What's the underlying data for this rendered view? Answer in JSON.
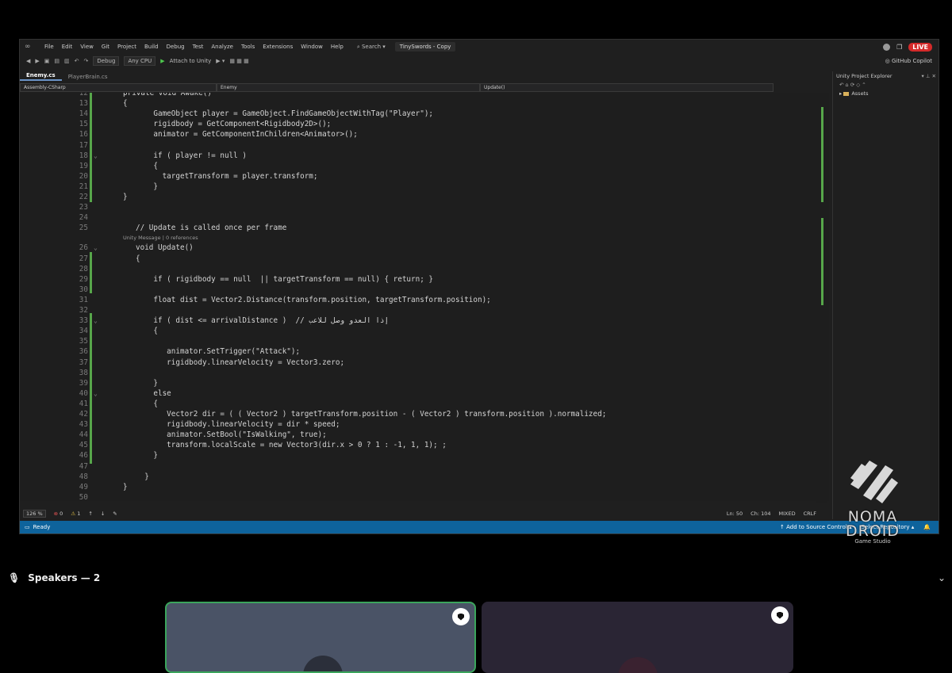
{
  "menubar": {
    "items": [
      "File",
      "Edit",
      "View",
      "Git",
      "Project",
      "Build",
      "Debug",
      "Test",
      "Analyze",
      "Tools",
      "Extensions",
      "Window",
      "Help"
    ],
    "search": "Search",
    "project": "TinySwords - Copy",
    "live": "LIVE"
  },
  "toolbar": {
    "config": "Debug",
    "platform": "Any CPU",
    "attach": "Attach to Unity",
    "copilot": "GitHub Copilot"
  },
  "tabs": [
    "Enemy.cs",
    "PlayerBrain.cs"
  ],
  "navbar": {
    "project": "Assembly-CSharp",
    "class": "Enemy",
    "member": "Update()"
  },
  "code_lines": [
    {
      "n": "12",
      "t": "private void Awake()"
    },
    {
      "n": "13",
      "t": "{"
    },
    {
      "n": "14",
      "t": "    GameObject player = GameObject.FindGameObjectWithTag(\"Player\");"
    },
    {
      "n": "15",
      "t": "    rigidbody = GetComponent<Rigidbody2D>();"
    },
    {
      "n": "16",
      "t": "    animator = GetComponentInChildren<Animator>();"
    },
    {
      "n": "17",
      "t": ""
    },
    {
      "n": "18",
      "t": "    if ( player != null )"
    },
    {
      "n": "19",
      "t": "    {"
    },
    {
      "n": "20",
      "t": "      targetTransform = player.transform;"
    },
    {
      "n": "21",
      "t": "    }"
    },
    {
      "n": "22",
      "t": "}"
    },
    {
      "n": "23",
      "t": ""
    },
    {
      "n": "24",
      "t": ""
    },
    {
      "n": "25",
      "t": "// Update is called once per frame"
    },
    {
      "n": "26",
      "t": "void Update()"
    },
    {
      "n": "27",
      "t": "{"
    },
    {
      "n": "28",
      "t": ""
    },
    {
      "n": "29",
      "t": "    if ( rigidbody == null  || targetTransform == null) { return; }"
    },
    {
      "n": "30",
      "t": ""
    },
    {
      "n": "31",
      "t": "    float dist = Vector2.Distance(transform.position, targetTransform.position);"
    },
    {
      "n": "32",
      "t": ""
    },
    {
      "n": "33",
      "t": "    if ( dist <= arrivalDistance )  // إذا العدو وصل للاعب"
    },
    {
      "n": "34",
      "t": "    {"
    },
    {
      "n": "35",
      "t": ""
    },
    {
      "n": "36",
      "t": "       animator.SetTrigger(\"Attack\");"
    },
    {
      "n": "37",
      "t": "       rigidbody.linearVelocity = Vector3.zero;"
    },
    {
      "n": "38",
      "t": ""
    },
    {
      "n": "39",
      "t": "    }"
    },
    {
      "n": "40",
      "t": "    else"
    },
    {
      "n": "41",
      "t": "    {"
    },
    {
      "n": "42",
      "t": "       Vector2 dir = ( ( Vector2 ) targetTransform.position - ( Vector2 ) transform.position ).normalized;"
    },
    {
      "n": "43",
      "t": "       rigidbody.linearVelocity = dir * speed;"
    },
    {
      "n": "44",
      "t": "       animator.SetBool(\"IsWalking\", true);"
    },
    {
      "n": "45",
      "t": "       transform.localScale = new Vector3(dir.x > 0 ? 1 : -1, 1, 1); ;"
    },
    {
      "n": "46",
      "t": "    }"
    },
    {
      "n": "47",
      "t": ""
    },
    {
      "n": "48",
      "t": "  }"
    },
    {
      "n": "49",
      "t": "}"
    },
    {
      "n": "50",
      "t": ""
    }
  ],
  "codelens": "Unity Message | 0 references",
  "editor_status": {
    "zoom": "126 %",
    "errors": "0",
    "warnings": "1",
    "ln": "Ln: 50",
    "ch": "Ch: 104",
    "mixed": "MIXED",
    "crlf": "CRLF"
  },
  "statusbar": {
    "ready": "Ready",
    "source_control": "Add to Source Control",
    "repository": "Select Repository"
  },
  "explorer": {
    "title": "Unity Project Explorer",
    "root": "Assets"
  },
  "watermark": {
    "line1": "NOMA",
    "line2": "DROID",
    "line3": "Game Studio"
  },
  "speakers": {
    "label": "Speakers — 2"
  }
}
